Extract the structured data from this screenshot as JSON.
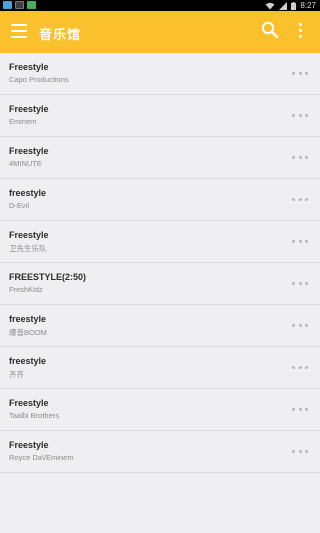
{
  "status_bar": {
    "time": "8:27",
    "icons": [
      "notification-icon-1",
      "notification-icon-2",
      "notification-icon-3",
      "wifi-icon",
      "signal-icon",
      "battery-icon"
    ]
  },
  "app_bar": {
    "title": "音乐馆",
    "background_color": "#fbc12d",
    "icons": [
      "menu-icon",
      "search-icon",
      "more-vert-icon"
    ]
  },
  "songs": [
    {
      "title": "Freestyle",
      "artist": "Capo Productions"
    },
    {
      "title": "Freestyle",
      "artist": "Eminem"
    },
    {
      "title": "Freestyle",
      "artist": "4MINUTE"
    },
    {
      "title": "freestyle",
      "artist": "D-Evil"
    },
    {
      "title": "Freestyle",
      "artist": "卫先生乐队"
    },
    {
      "title": "FREESTYLE(2:50)",
      "artist": "FreshKidz"
    },
    {
      "title": "freestyle",
      "artist": "爆音BOOM"
    },
    {
      "title": "freestyle",
      "artist": "齐齐"
    },
    {
      "title": "Freestyle",
      "artist": "Taalbi Brothers"
    },
    {
      "title": "Freestyle",
      "artist": "Royce Da\\/Eminem"
    }
  ],
  "row_more_icon": "more-horiz-icon"
}
